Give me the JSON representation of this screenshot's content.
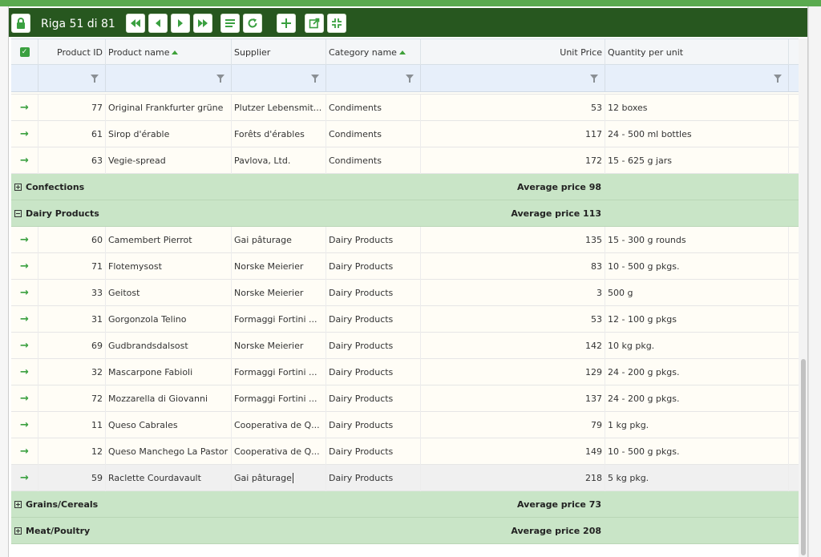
{
  "toolbar": {
    "record_label": "Riga 51 di 81",
    "icons": [
      "lock-icon",
      "first-record-icon",
      "previous-record-icon",
      "next-record-icon",
      "last-record-icon",
      "list-icon",
      "refresh-icon",
      "add-icon",
      "open-external-icon",
      "collapse-icon"
    ]
  },
  "columns": {
    "product_id": "Product ID",
    "product_name": "Product name",
    "supplier": "Supplier",
    "category": "Category name",
    "unit_price": "Unit Price",
    "quantity": "Quantity per unit"
  },
  "rows_top": [
    {
      "id": "77",
      "name": "Original Frankfurter grüne",
      "supplier": "Plutzer Lebensmit...",
      "category": "Condiments",
      "price": "53",
      "qty": "12 boxes"
    },
    {
      "id": "61",
      "name": "Sirop d'érable",
      "supplier": "Forêts d'érables",
      "category": "Condiments",
      "price": "117",
      "qty": "24 - 500 ml bottles"
    },
    {
      "id": "63",
      "name": "Vegie-spread",
      "supplier": "Pavlova, Ltd.",
      "category": "Condiments",
      "price": "172",
      "qty": "15 - 625 g jars"
    }
  ],
  "groups": [
    {
      "name": "Confections",
      "avg": "Average price 98"
    },
    {
      "name": "Dairy Products",
      "avg": "Average price 113"
    },
    {
      "name": "Grains/Cereals",
      "avg": "Average price 73"
    },
    {
      "name": "Meat/Poultry",
      "avg": "Average price 208"
    }
  ],
  "rows_dairy": [
    {
      "id": "60",
      "name": "Camembert Pierrot",
      "supplier": "Gai pâturage",
      "category": "Dairy Products",
      "price": "135",
      "qty": "15 - 300 g rounds"
    },
    {
      "id": "71",
      "name": "Flotemysost",
      "supplier": "Norske Meierier",
      "category": "Dairy Products",
      "price": "83",
      "qty": "10 - 500 g pkgs."
    },
    {
      "id": "33",
      "name": "Geitost",
      "supplier": "Norske Meierier",
      "category": "Dairy Products",
      "price": "3",
      "qty": "500 g"
    },
    {
      "id": "31",
      "name": "Gorgonzola Telino",
      "supplier": "Formaggi Fortini ...",
      "category": "Dairy Products",
      "price": "53",
      "qty": "12 - 100 g pkgs"
    },
    {
      "id": "69",
      "name": "Gudbrandsdalsost",
      "supplier": "Norske Meierier",
      "category": "Dairy Products",
      "price": "142",
      "qty": "10 kg pkg."
    },
    {
      "id": "32",
      "name": "Mascarpone Fabioli",
      "supplier": "Formaggi Fortini ...",
      "category": "Dairy Products",
      "price": "129",
      "qty": "24 - 200 g pkgs."
    },
    {
      "id": "72",
      "name": "Mozzarella di Giovanni",
      "supplier": "Formaggi Fortini ...",
      "category": "Dairy Products",
      "price": "137",
      "qty": "24 - 200 g pkgs."
    },
    {
      "id": "11",
      "name": "Queso Cabrales",
      "supplier": "Cooperativa de Q...",
      "category": "Dairy Products",
      "price": "79",
      "qty": "1 kg pkg."
    },
    {
      "id": "12",
      "name": "Queso Manchego La Pastor",
      "supplier": "Cooperativa de Q...",
      "category": "Dairy Products",
      "price": "149",
      "qty": "10 - 500 g pkgs."
    },
    {
      "id": "59",
      "name": "Raclette Courdavault",
      "supplier": "Gai pâturage",
      "category": "Dairy Products",
      "price": "218",
      "qty": "5 kg pkg."
    }
  ],
  "arrow_glyph": "→",
  "colors": {
    "toolbar": "#27571f",
    "accent": "#3aa040",
    "group_bg": "#c9e5c7",
    "filter_bg": "#e7effa"
  }
}
